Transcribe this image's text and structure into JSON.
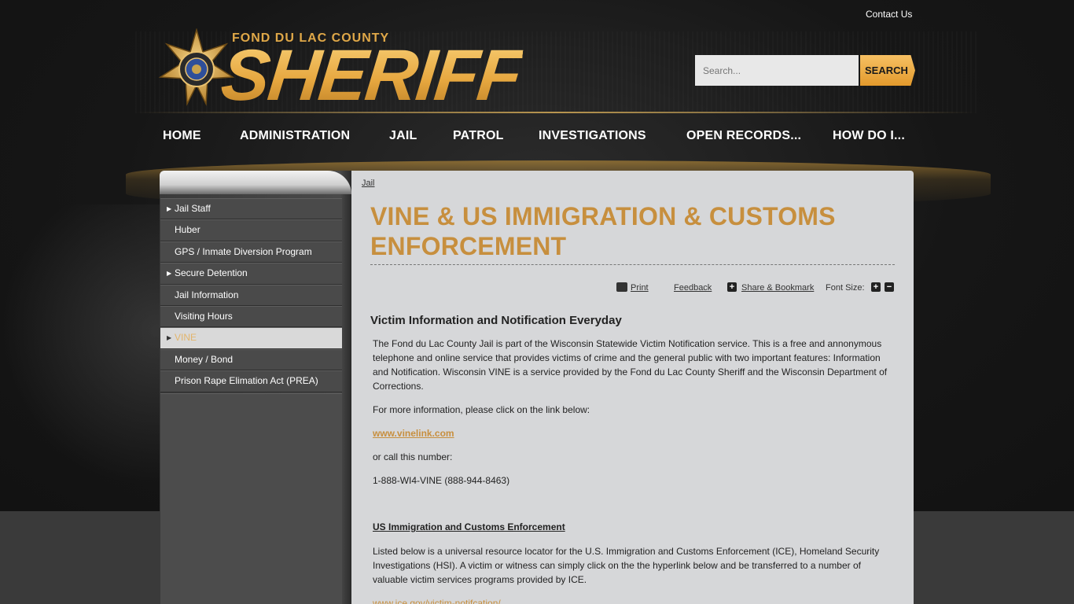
{
  "header": {
    "contact_label": "Contact Us",
    "logo_county": "FOND DU LAC COUNTY",
    "logo_title": "SHERIFF",
    "search_placeholder": "Search...",
    "search_button": "SEARCH"
  },
  "nav": {
    "items": [
      "HOME",
      "ADMINISTRATION",
      "JAIL",
      "PATROL",
      "INVESTIGATIONS",
      "OPEN RECORDS...",
      "HOW DO I..."
    ]
  },
  "sidebar": {
    "items": [
      {
        "label": "Jail Staff",
        "has_arrow": true
      },
      {
        "label": "Huber",
        "has_arrow": false
      },
      {
        "label": "GPS / Inmate Diversion Program",
        "has_arrow": false
      },
      {
        "label": "Secure Detention",
        "has_arrow": true
      },
      {
        "label": "Jail Information",
        "has_arrow": false
      },
      {
        "label": "Visiting Hours",
        "has_arrow": false
      },
      {
        "label": "VINE",
        "has_arrow": true,
        "active": true
      },
      {
        "label": "Money / Bond",
        "has_arrow": false
      },
      {
        "label": "Prison Rape Elimation Act (PREA)",
        "has_arrow": false
      }
    ]
  },
  "content": {
    "breadcrumb": "Jail",
    "title": "VINE & US IMMIGRATION & CUSTOMS ENFORCEMENT",
    "tools": {
      "print": "Print",
      "feedback": "Feedback",
      "share": "Share & Bookmark",
      "font_size": "Font Size:"
    },
    "section_heading": "Victim Information and Notification Everyday",
    "para1": "The Fond du Lac County Jail is part of the Wisconsin Statewide Victim Notification service. This is a free and annonymous telephone and online service that provides victims of crime and the general public with two important features: Information and Notification. Wisconsin VINE is a service provided by the Fond du Lac County Sheriff and the Wisconsin Department of Corrections.",
    "para2": "For more information, please click on the link below:",
    "vine_link": "www.vinelink.com",
    "para3": "or call this number:",
    "phone": "1-888-WI4-VINE (888-944-8463)",
    "ice_heading": "US Immigration and Customs Enforcement",
    "para4": "Listed below is a universal resource locator for the U.S. Immigration and Customs Enforcement (ICE), Homeland Security Investigations (HSI).  A victim or witness can simply click on the the hyperlink below and be transferred to a number of valuable victim services programs provided by ICE.",
    "ice_link": "www.ice.gov/victim-notifcation/"
  },
  "colors": {
    "accent_gold": "#c78f3e",
    "content_bg": "#d6d7d9",
    "sidebar_bg": "#4a4a4a"
  }
}
